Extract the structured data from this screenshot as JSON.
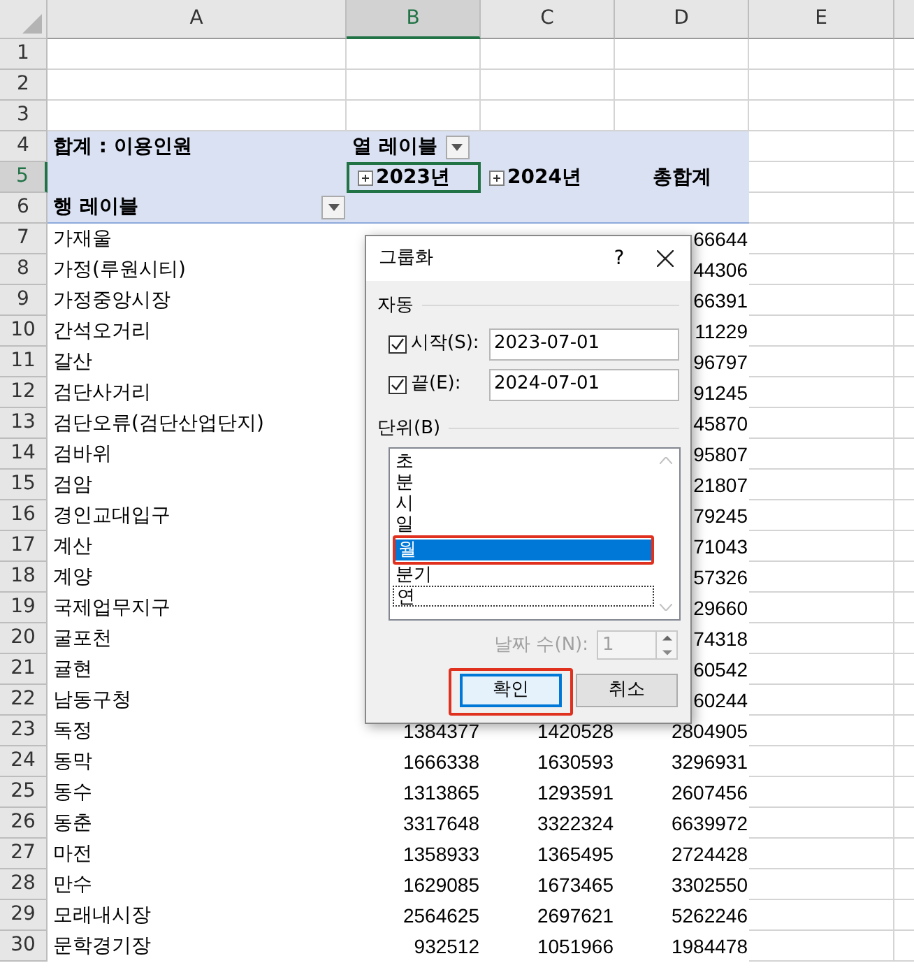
{
  "columns": [
    {
      "label": "A",
      "selected": false
    },
    {
      "label": "B",
      "selected": true
    },
    {
      "label": "C",
      "selected": false
    },
    {
      "label": "D",
      "selected": false
    },
    {
      "label": "E",
      "selected": false
    }
  ],
  "row_numbers": [
    {
      "label": "1",
      "selected": false
    },
    {
      "label": "2",
      "selected": false
    },
    {
      "label": "3",
      "selected": false
    },
    {
      "label": "4",
      "selected": false
    },
    {
      "label": "5",
      "selected": true
    },
    {
      "label": "6",
      "selected": false
    },
    {
      "label": "7",
      "selected": false
    },
    {
      "label": "8",
      "selected": false
    },
    {
      "label": "9",
      "selected": false
    },
    {
      "label": "10",
      "selected": false
    },
    {
      "label": "11",
      "selected": false
    },
    {
      "label": "12",
      "selected": false
    },
    {
      "label": "13",
      "selected": false
    },
    {
      "label": "14",
      "selected": false
    },
    {
      "label": "15",
      "selected": false
    },
    {
      "label": "16",
      "selected": false
    },
    {
      "label": "17",
      "selected": false
    },
    {
      "label": "18",
      "selected": false
    },
    {
      "label": "19",
      "selected": false
    },
    {
      "label": "20",
      "selected": false
    },
    {
      "label": "21",
      "selected": false
    },
    {
      "label": "22",
      "selected": false
    },
    {
      "label": "23",
      "selected": false
    },
    {
      "label": "24",
      "selected": false
    },
    {
      "label": "25",
      "selected": false
    },
    {
      "label": "26",
      "selected": false
    },
    {
      "label": "27",
      "selected": false
    },
    {
      "label": "28",
      "selected": false
    },
    {
      "label": "29",
      "selected": false
    },
    {
      "label": "30",
      "selected": false
    }
  ],
  "pivot": {
    "value_label": "합계 : 이용인원",
    "column_label": "열 레이블",
    "column_groups": [
      {
        "label": "2023년",
        "selected": true
      },
      {
        "label": "2024년",
        "selected": false
      }
    ],
    "grand_total": "총합계",
    "row_label": "행 레이블"
  },
  "data_rows": [
    {
      "name": "가재울",
      "col_d": "66644"
    },
    {
      "name": "가정(루원시티)",
      "col_d": "44306"
    },
    {
      "name": "가정중앙시장",
      "col_d": "66391"
    },
    {
      "name": "간석오거리",
      "col_d": "11229"
    },
    {
      "name": "갈산",
      "col_d": "96797"
    },
    {
      "name": "검단사거리",
      "col_d": "91245"
    },
    {
      "name": "검단오류(검단산업단지)",
      "col_d": "45870"
    },
    {
      "name": "검바위",
      "col_d": "95807"
    },
    {
      "name": "검암",
      "col_d": "21807"
    },
    {
      "name": "경인교대입구",
      "col_d": "79245"
    },
    {
      "name": "계산",
      "col_d": "71043"
    },
    {
      "name": "계양",
      "col_d": "57326"
    },
    {
      "name": "국제업무지구",
      "col_d": "29660"
    },
    {
      "name": "굴포천",
      "col_d": "74318"
    },
    {
      "name": "귤현",
      "col_d": "60542"
    },
    {
      "name": "남동구청",
      "col_d": "60244"
    },
    {
      "name": "독정",
      "col_b": "1384377",
      "col_c": "1420528",
      "col_d": "2804905"
    },
    {
      "name": "동막",
      "col_b": "1666338",
      "col_c": "1630593",
      "col_d": "3296931"
    },
    {
      "name": "동수",
      "col_b": "1313865",
      "col_c": "1293591",
      "col_d": "2607456"
    },
    {
      "name": "동춘",
      "col_b": "3317648",
      "col_c": "3322324",
      "col_d": "6639972"
    },
    {
      "name": "마전",
      "col_b": "1358933",
      "col_c": "1365495",
      "col_d": "2724428"
    },
    {
      "name": "만수",
      "col_b": "1629085",
      "col_c": "1673465",
      "col_d": "3302550"
    },
    {
      "name": "모래내시장",
      "col_b": "2564625",
      "col_c": "2697621",
      "col_d": "5262246"
    },
    {
      "name": "문학경기장",
      "col_b": "932512",
      "col_c": "1051966",
      "col_d": "1984478"
    }
  ],
  "dialog": {
    "title": "그룹화",
    "help": "?",
    "auto_section": "자동",
    "fields": [
      {
        "label": "시작(S):",
        "checked": true,
        "value": "2023-07-01"
      },
      {
        "label": "끝(E):",
        "checked": true,
        "value": "2024-07-01"
      }
    ],
    "unit_section": "단위(B)",
    "units": [
      {
        "label": "초",
        "selected": false,
        "focused": false,
        "annotated": false
      },
      {
        "label": "분",
        "selected": false,
        "focused": false,
        "annotated": false
      },
      {
        "label": "시",
        "selected": false,
        "focused": false,
        "annotated": false
      },
      {
        "label": "일",
        "selected": false,
        "focused": false,
        "annotated": false
      },
      {
        "label": "월",
        "selected": true,
        "focused": false,
        "annotated": true
      },
      {
        "label": "분기",
        "selected": false,
        "focused": false,
        "annotated": false
      },
      {
        "label": "연",
        "selected": false,
        "focused": true,
        "annotated": false
      }
    ],
    "days": {
      "label": "날짜 수(N):",
      "value": "1",
      "disabled": true
    },
    "buttons": [
      {
        "label": "확인",
        "default": true,
        "annotated": true
      },
      {
        "label": "취소",
        "default": false,
        "annotated": false
      }
    ]
  }
}
